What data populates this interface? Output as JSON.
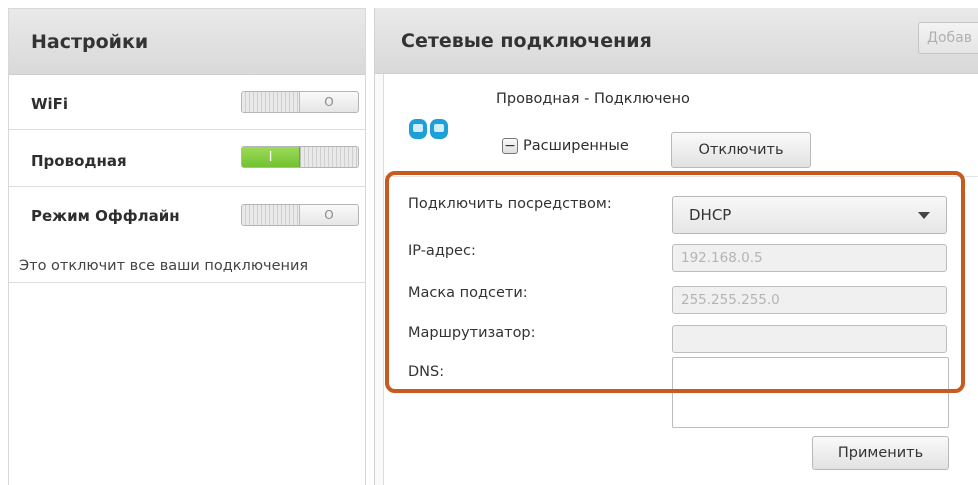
{
  "settings": {
    "title": "Настройки",
    "wifi": {
      "label": "WiFi",
      "state": "off",
      "off_symbol": "O"
    },
    "wired": {
      "label": "Проводная",
      "state": "on",
      "on_symbol": "I"
    },
    "offline": {
      "label": "Режим Оффлайн",
      "state": "off",
      "off_symbol": "O",
      "description": "Это отключит все ваши подключения"
    }
  },
  "connections": {
    "title": "Сетевые подключения",
    "add_button": "Добав",
    "connection": {
      "icon": "network-connection-icon",
      "status": "Проводная - Подключено",
      "advanced_label": "Расширенные",
      "disconnect_button": "Отключить"
    },
    "form": {
      "connect_via_label": "Подключить посредством:",
      "connect_via_value": "DHCP",
      "ip_label": "IP-адрес:",
      "ip_value": "192.168.0.5",
      "mask_label": "Маска подсети:",
      "mask_value": "255.255.255.0",
      "router_label": "Маршрутизатор:",
      "router_value": "",
      "dns_label": "DNS:",
      "dns_value": "",
      "apply_button": "Применить"
    }
  },
  "colors": {
    "toggle_on": "#7ccd38",
    "highlight_border": "#c75a1e",
    "header_bg": "#e0e0e0"
  }
}
